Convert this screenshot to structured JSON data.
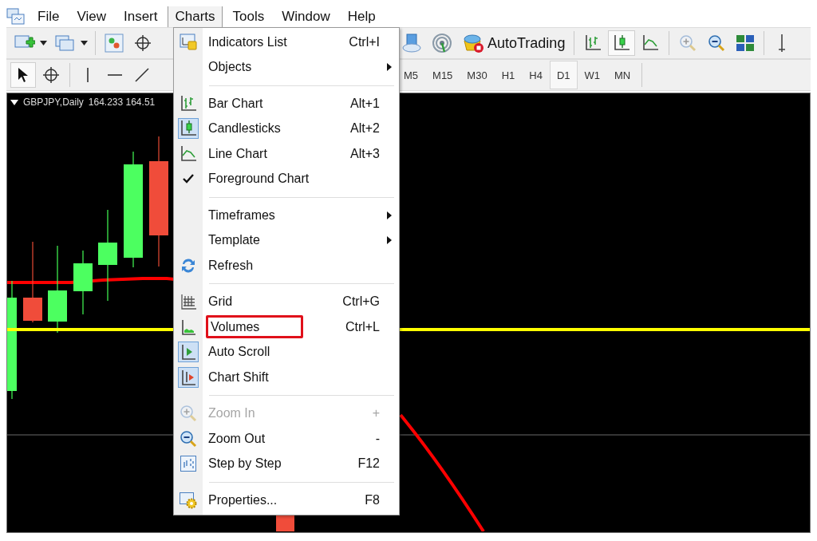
{
  "menu_bar": {
    "items": [
      {
        "label": "File",
        "selected": false
      },
      {
        "label": "View",
        "selected": false
      },
      {
        "label": "Insert",
        "selected": false
      },
      {
        "label": "Charts",
        "selected": true
      },
      {
        "label": "Tools",
        "selected": false
      },
      {
        "label": "Window",
        "selected": false
      },
      {
        "label": "Help",
        "selected": false
      }
    ]
  },
  "standard_toolbar": {
    "left_buttons": [
      {
        "kind": "new-chart"
      },
      {
        "kind": "dropdown"
      },
      {
        "kind": "profiles"
      },
      {
        "kind": "dropdown"
      },
      {
        "kind": "navigator"
      },
      {
        "kind": "crosshair"
      }
    ],
    "right_buttons": [
      {
        "kind": "cloud",
        "selected": false,
        "disabled": false
      },
      {
        "kind": "signal",
        "selected": false,
        "disabled": false
      },
      {
        "kind": "autotrading",
        "label": "AutoTrading",
        "selected": false,
        "disabled": false
      },
      {
        "kind": "bar-chart",
        "selected": false,
        "disabled": false
      },
      {
        "kind": "candles",
        "selected": true,
        "disabled": false
      },
      {
        "kind": "line-chart",
        "selected": false,
        "disabled": false
      },
      {
        "kind": "zoom-in",
        "selected": false,
        "disabled": true
      },
      {
        "kind": "zoom-out",
        "selected": false,
        "disabled": false
      },
      {
        "kind": "tile",
        "selected": false,
        "disabled": false
      },
      {
        "kind": "period-sep",
        "selected": false,
        "disabled": false
      }
    ]
  },
  "drawing_toolbar": {
    "tools": [
      {
        "kind": "cursor",
        "selected": true
      },
      {
        "kind": "crosshair",
        "selected": false
      },
      {
        "kind": "vertical",
        "selected": false
      },
      {
        "kind": "horizontal",
        "selected": false
      },
      {
        "kind": "trend",
        "selected": false
      }
    ],
    "timeframes": [
      {
        "label": "M5",
        "selected": false
      },
      {
        "label": "M15",
        "selected": false
      },
      {
        "label": "M30",
        "selected": false
      },
      {
        "label": "H1",
        "selected": false
      },
      {
        "label": "H4",
        "selected": false
      },
      {
        "label": "D1",
        "selected": true
      },
      {
        "label": "W1",
        "selected": false
      },
      {
        "label": "MN",
        "selected": false
      }
    ]
  },
  "chart": {
    "symbol": "GBPJPY,Daily",
    "prices": "164.233 164.51"
  },
  "charts_menu": {
    "sections": [
      [
        {
          "kind": "indicators",
          "label": "Indicators List",
          "shortcut": "Ctrl+I",
          "submenu": false,
          "disabled": false,
          "checked": false,
          "selected": false,
          "annotated": false
        },
        {
          "label": "Objects",
          "submenu": true,
          "disabled": false,
          "checked": false,
          "selected": false,
          "annotated": false
        }
      ],
      [
        {
          "kind": "bar-chart",
          "label": "Bar Chart",
          "shortcut": "Alt+1",
          "submenu": false,
          "disabled": false,
          "checked": false,
          "selected": false,
          "annotated": false
        },
        {
          "kind": "candles",
          "label": "Candlesticks",
          "shortcut": "Alt+2",
          "submenu": false,
          "disabled": false,
          "checked": false,
          "selected": true,
          "annotated": false
        },
        {
          "kind": "line-chart",
          "label": "Line Chart",
          "shortcut": "Alt+3",
          "submenu": false,
          "disabled": false,
          "checked": false,
          "selected": false,
          "annotated": false
        },
        {
          "label": "Foreground Chart",
          "submenu": false,
          "disabled": false,
          "checked": true,
          "selected": false,
          "annotated": false
        }
      ],
      [
        {
          "label": "Timeframes",
          "submenu": true,
          "disabled": false,
          "checked": false,
          "selected": false,
          "annotated": false
        },
        {
          "label": "Template",
          "submenu": true,
          "disabled": false,
          "checked": false,
          "selected": false,
          "annotated": false
        },
        {
          "kind": "refresh",
          "label": "Refresh",
          "submenu": false,
          "disabled": false,
          "checked": false,
          "selected": false,
          "annotated": false
        }
      ],
      [
        {
          "kind": "grid",
          "label": "Grid",
          "shortcut": "Ctrl+G",
          "submenu": false,
          "disabled": false,
          "checked": false,
          "selected": false,
          "annotated": false
        },
        {
          "kind": "volumes",
          "label": "Volumes",
          "shortcut": "Ctrl+L",
          "submenu": false,
          "disabled": false,
          "checked": false,
          "selected": false,
          "annotated": true
        },
        {
          "kind": "auto-scroll",
          "label": "Auto Scroll",
          "submenu": false,
          "disabled": false,
          "checked": false,
          "selected": true,
          "annotated": false
        },
        {
          "kind": "chart-shift",
          "label": "Chart Shift",
          "submenu": false,
          "disabled": false,
          "checked": false,
          "selected": true,
          "annotated": false
        }
      ],
      [
        {
          "kind": "zoom-in",
          "label": "Zoom In",
          "shortcut": "+",
          "submenu": false,
          "disabled": true,
          "checked": false,
          "selected": false,
          "annotated": false
        },
        {
          "kind": "zoom-out",
          "label": "Zoom Out",
          "shortcut": "-",
          "submenu": false,
          "disabled": false,
          "checked": false,
          "selected": false,
          "annotated": false
        },
        {
          "kind": "step",
          "label": "Step by Step",
          "shortcut": "F12",
          "submenu": false,
          "disabled": false,
          "checked": false,
          "selected": false,
          "annotated": false
        }
      ],
      [
        {
          "kind": "properties",
          "label": "Properties...",
          "shortcut": "F8",
          "submenu": false,
          "disabled": false,
          "checked": false,
          "selected": false,
          "annotated": false
        }
      ]
    ]
  }
}
